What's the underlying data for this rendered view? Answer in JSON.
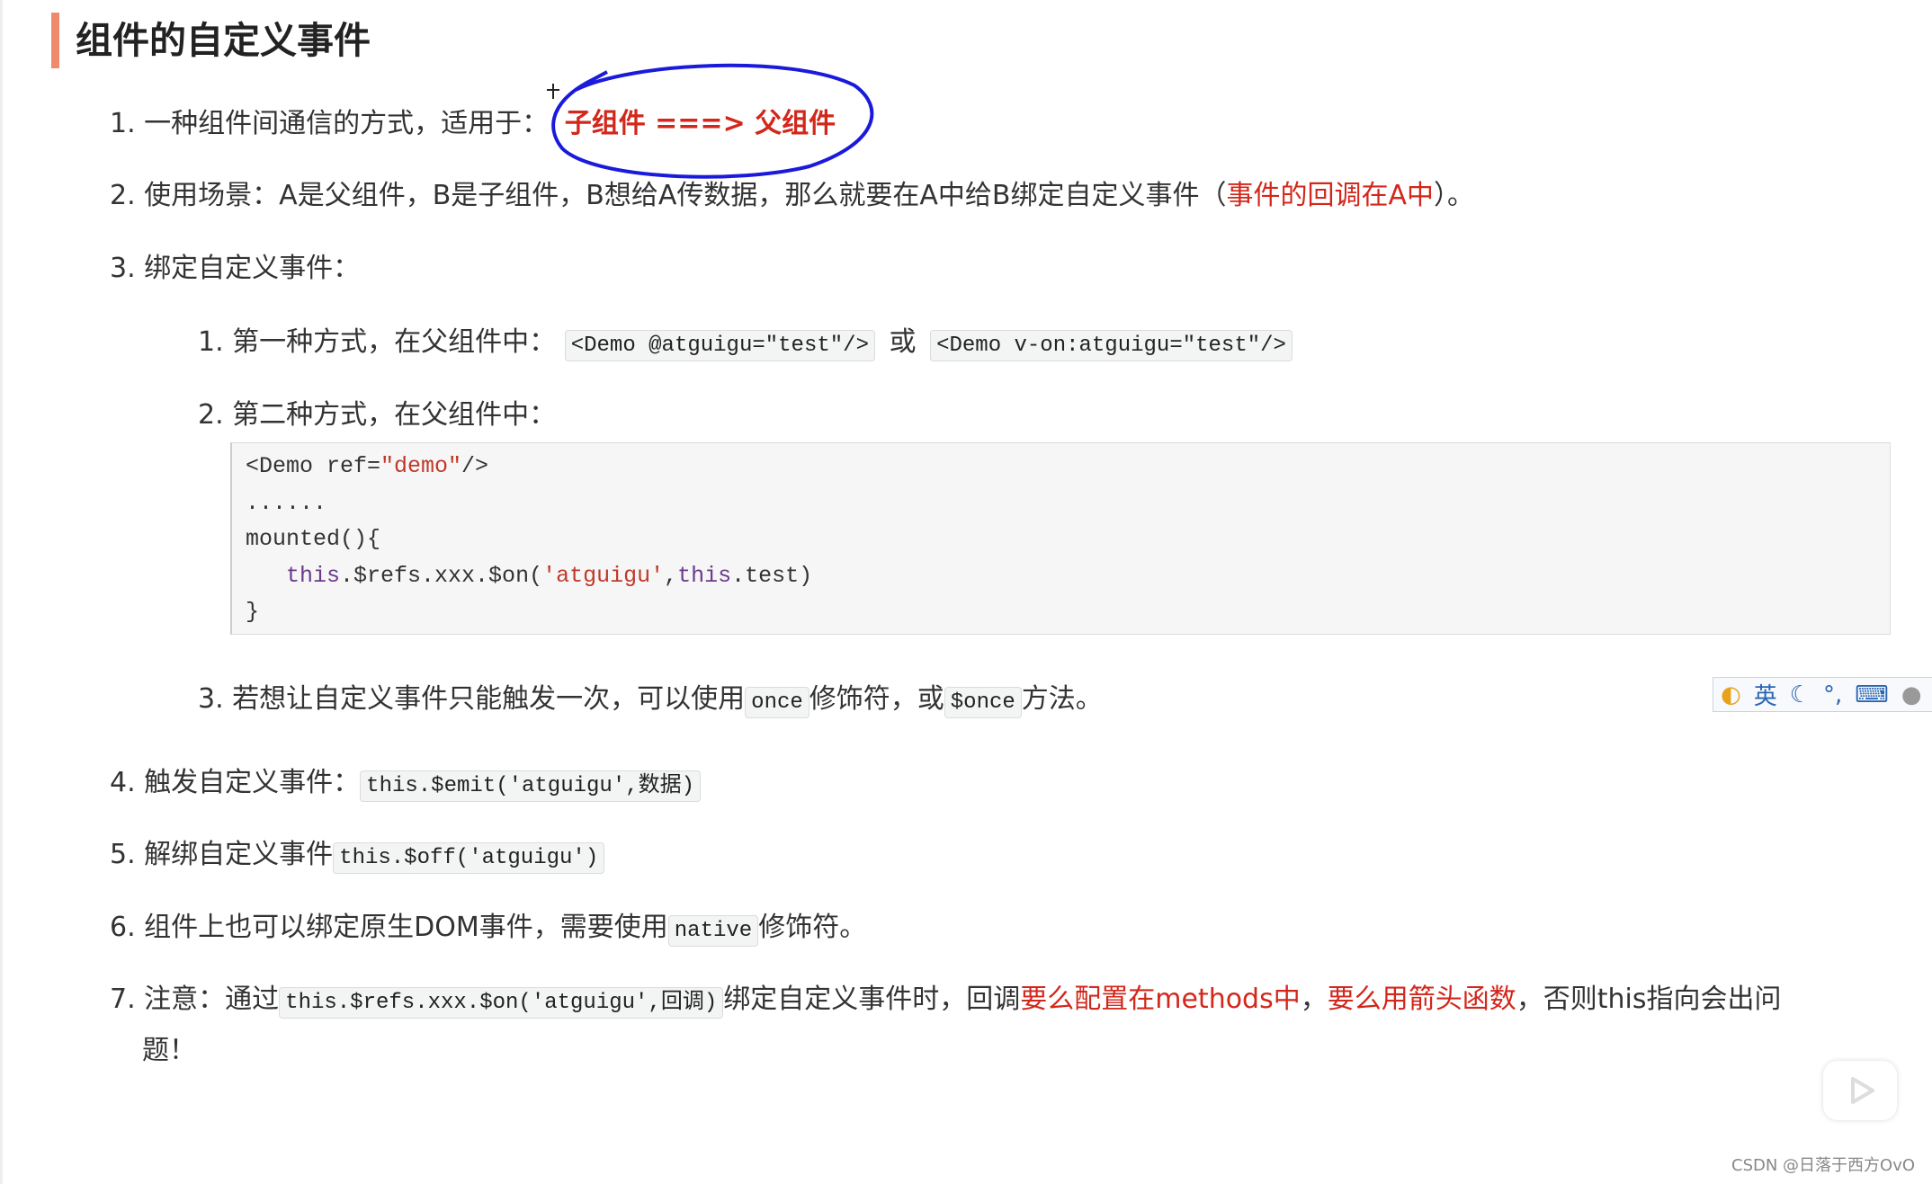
{
  "heading": "组件的自定义事件",
  "items": {
    "i1": {
      "num": "1.",
      "text": "一种组件间通信的方式，适用于：",
      "highlight": "子组件 ===> 父组件"
    },
    "i2": {
      "num": "2.",
      "text": "使用场景：A是父组件，B是子组件，B想给A传数据，那么就要在A中给B绑定自定义事件（",
      "red": "事件的回调在A中",
      "tail": "）。"
    },
    "i3": {
      "num": "3.",
      "text": "绑定自定义事件：",
      "s1": {
        "num": "1.",
        "text": "第一种方式，在父组件中：",
        "code1": "<Demo @atguigu=\"test\"/>",
        "or": "或",
        "code2": "<Demo v-on:atguigu=\"test\"/>"
      },
      "s2": {
        "num": "2.",
        "text": "第二种方式，在父组件中：",
        "code": {
          "l1a": "<Demo ref=",
          "l1b": "\"demo\"",
          "l1c": "/>",
          "l2": "......",
          "l3": "mounted(){",
          "l4a": "   this",
          "l4b": ".$refs.xxx.$on(",
          "l4c": "'atguigu'",
          "l4d": ",",
          "l4e": "this",
          ".l4f": "",
          "l4g": ".test)",
          "l5": "}"
        }
      },
      "s3": {
        "num": "3.",
        "text": "若想让自定义事件只能触发一次，可以使用",
        "code1": "once",
        "mid": "修饰符，或",
        "code2": "$once",
        "tail": "方法。"
      }
    },
    "i4": {
      "num": "4.",
      "text": "触发自定义事件：",
      "code": "this.$emit('atguigu',数据)"
    },
    "i5": {
      "num": "5.",
      "text": "解绑自定义事件",
      "code": "this.$off('atguigu')"
    },
    "i6": {
      "num": "6.",
      "text": "组件上也可以绑定原生DOM事件，需要使用",
      "code": "native",
      "tail": "修饰符。"
    },
    "i7": {
      "num": "7.",
      "text": "注意：通过",
      "code": "this.$refs.xxx.$on('atguigu',回调)",
      "mid": "绑定自定义事件时，回调",
      "red1": "要么配置在methods中",
      "comma": "，",
      "red2": "要么用箭头函数",
      "tail": "，否则this指向会出问",
      "wrap": "题！"
    }
  },
  "ime": {
    "lang": "英",
    "icons": [
      "ime-logo-icon",
      "moon-icon",
      "punctuation-icon",
      "keyboard-icon",
      "user-icon",
      "wrench-icon"
    ]
  },
  "watermark": "CSDN @日落于西方OvO",
  "colors": {
    "accent_bar": "#f08a6c",
    "red_text": "#d2271b",
    "annotation": "#1a1adb"
  }
}
